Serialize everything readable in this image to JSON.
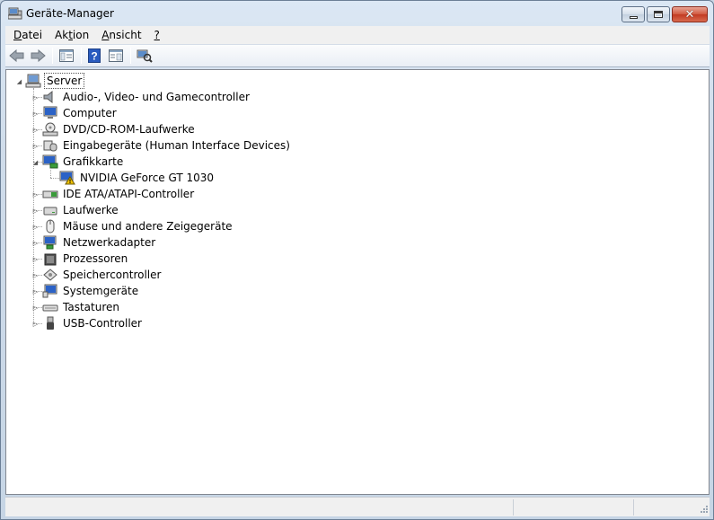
{
  "window": {
    "title": "Geräte-Manager",
    "icon": "device-manager-icon"
  },
  "menu": {
    "items": [
      {
        "label": "Datei",
        "accel": "D",
        "rest": "atei"
      },
      {
        "label": "Aktion",
        "pre": "Ak",
        "accel": "t",
        "rest": "ion"
      },
      {
        "label": "Ansicht",
        "accel": "A",
        "rest": "nsicht"
      },
      {
        "label": "?",
        "accel": "?",
        "rest": ""
      }
    ]
  },
  "toolbar": {
    "buttons": [
      "back-arrow-icon",
      "forward-arrow-icon",
      "show-hide-console-tree-icon",
      "help-icon",
      "properties-icon",
      "scan-hardware-icon"
    ]
  },
  "tree": {
    "root": {
      "label": "Server",
      "icon": "computer-icon",
      "expanded": true
    },
    "categories": [
      {
        "label": "Audio-, Video- und Gamecontroller",
        "icon": "speaker-icon",
        "expanded": false
      },
      {
        "label": "Computer",
        "icon": "monitor-icon",
        "expanded": false
      },
      {
        "label": "DVD/CD-ROM-Laufwerke",
        "icon": "disc-drive-icon",
        "expanded": false
      },
      {
        "label": "Eingabegeräte (Human Interface Devices)",
        "icon": "hid-icon",
        "expanded": false
      },
      {
        "label": "Grafikkarte",
        "icon": "display-adapter-icon",
        "expanded": true,
        "children": [
          {
            "label": "NVIDIA GeForce GT 1030",
            "icon": "warning-display-icon"
          }
        ]
      },
      {
        "label": "IDE ATA/ATAPI-Controller",
        "icon": "ide-controller-icon",
        "expanded": false
      },
      {
        "label": "Laufwerke",
        "icon": "disk-drive-icon",
        "expanded": false
      },
      {
        "label": "Mäuse und andere Zeigegeräte",
        "icon": "mouse-icon",
        "expanded": false
      },
      {
        "label": "Netzwerkadapter",
        "icon": "network-adapter-icon",
        "expanded": false
      },
      {
        "label": "Prozessoren",
        "icon": "processor-icon",
        "expanded": false
      },
      {
        "label": "Speichercontroller",
        "icon": "storage-controller-icon",
        "expanded": false
      },
      {
        "label": "Systemgeräte",
        "icon": "system-devices-icon",
        "expanded": false
      },
      {
        "label": "Tastaturen",
        "icon": "keyboard-icon",
        "expanded": false
      },
      {
        "label": "USB-Controller",
        "icon": "usb-icon",
        "expanded": false
      }
    ]
  },
  "colors": {
    "frame": "#c9d7e6",
    "close_button": "#c13a22",
    "selection_border": "#555555",
    "warning": "#f2c200"
  }
}
